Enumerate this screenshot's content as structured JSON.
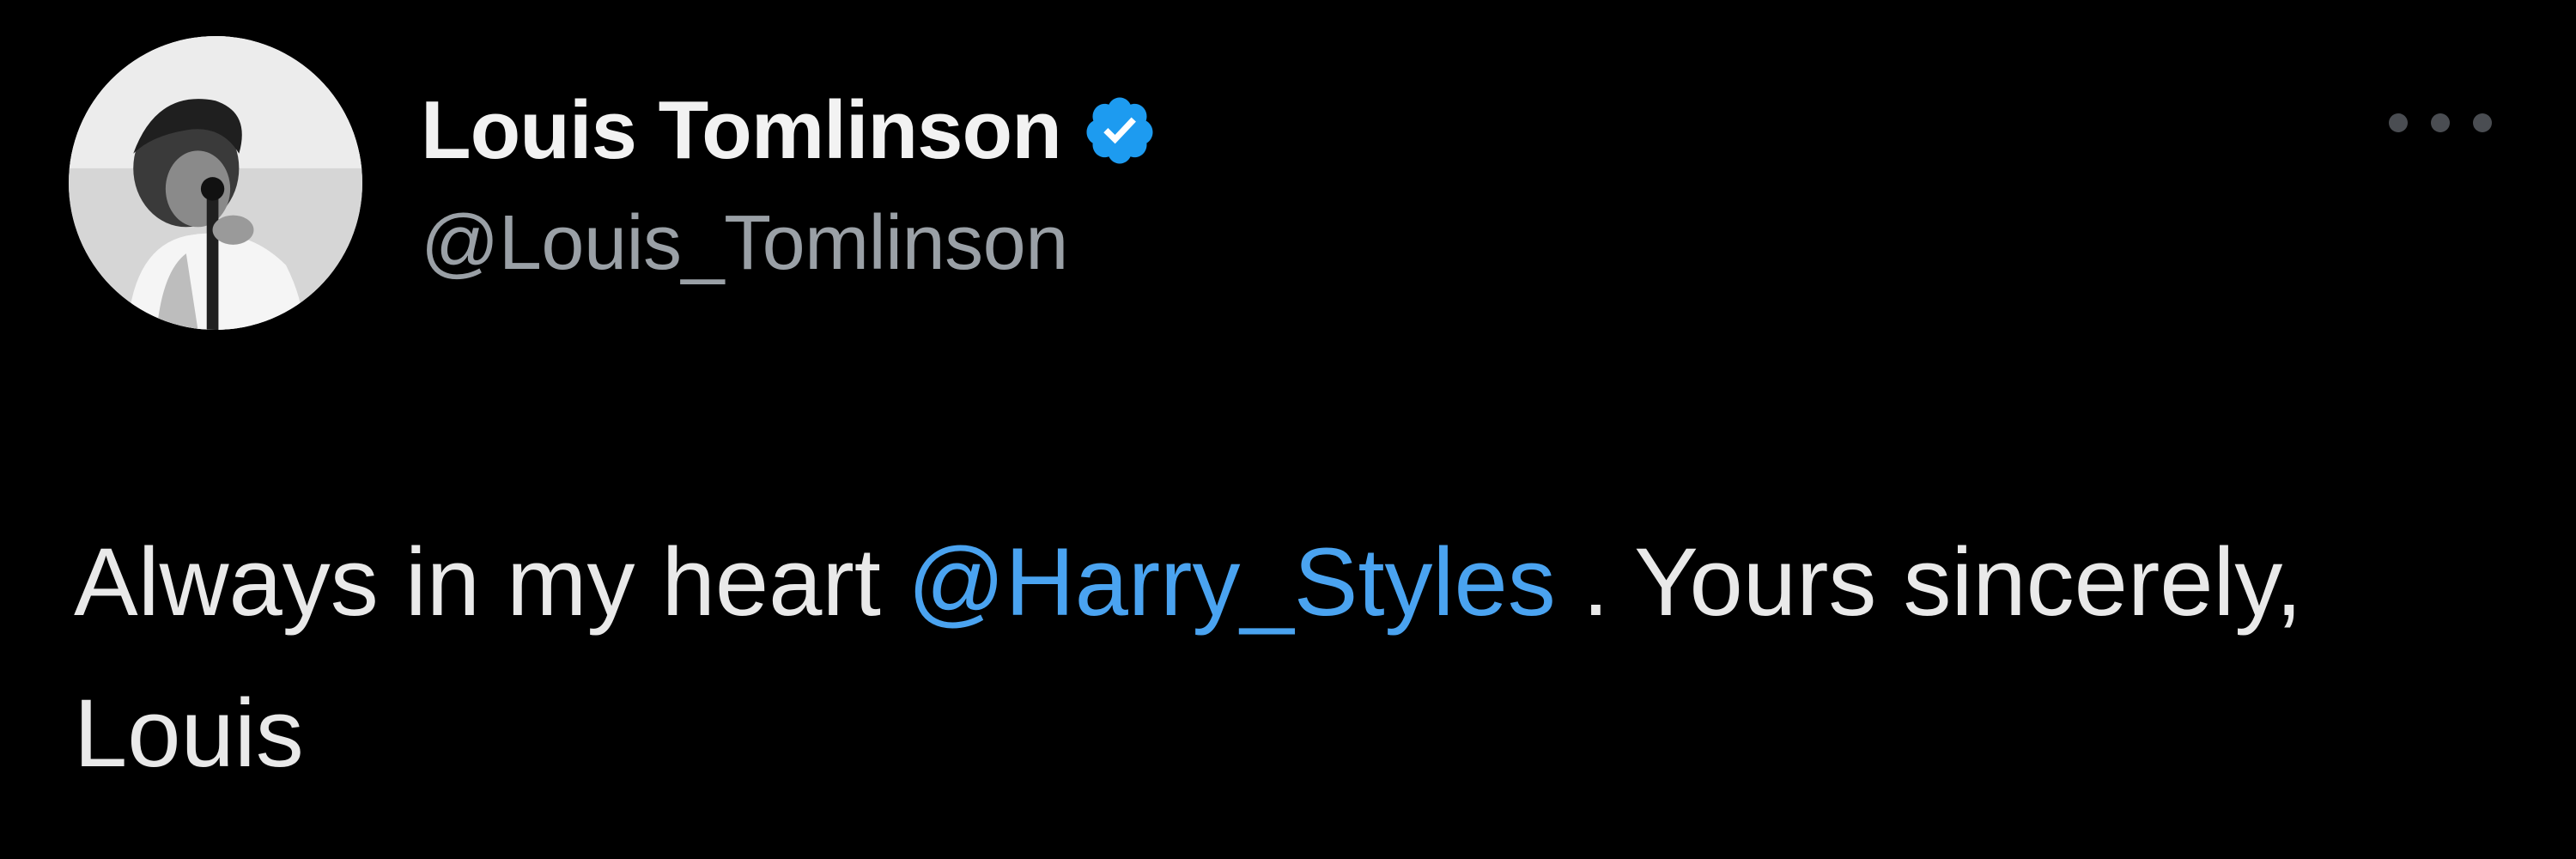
{
  "tweet": {
    "author": {
      "display_name": "Louis Tomlinson",
      "handle": "@Louis_Tomlinson",
      "avatar_icon": "profile-photo-black-and-white",
      "verified_icon": "verified-badge-icon"
    },
    "menu": {
      "icon": "more-options-icon"
    },
    "text": {
      "part1": "Always in my heart ",
      "mention": "@Harry_Styles",
      "part2": " . Yours sincerely, Louis"
    }
  },
  "colors": {
    "background": "#000000",
    "mention": "#4aa3f0",
    "verified": "#1d9bf0",
    "secondary_text": "#9aa0a6"
  }
}
